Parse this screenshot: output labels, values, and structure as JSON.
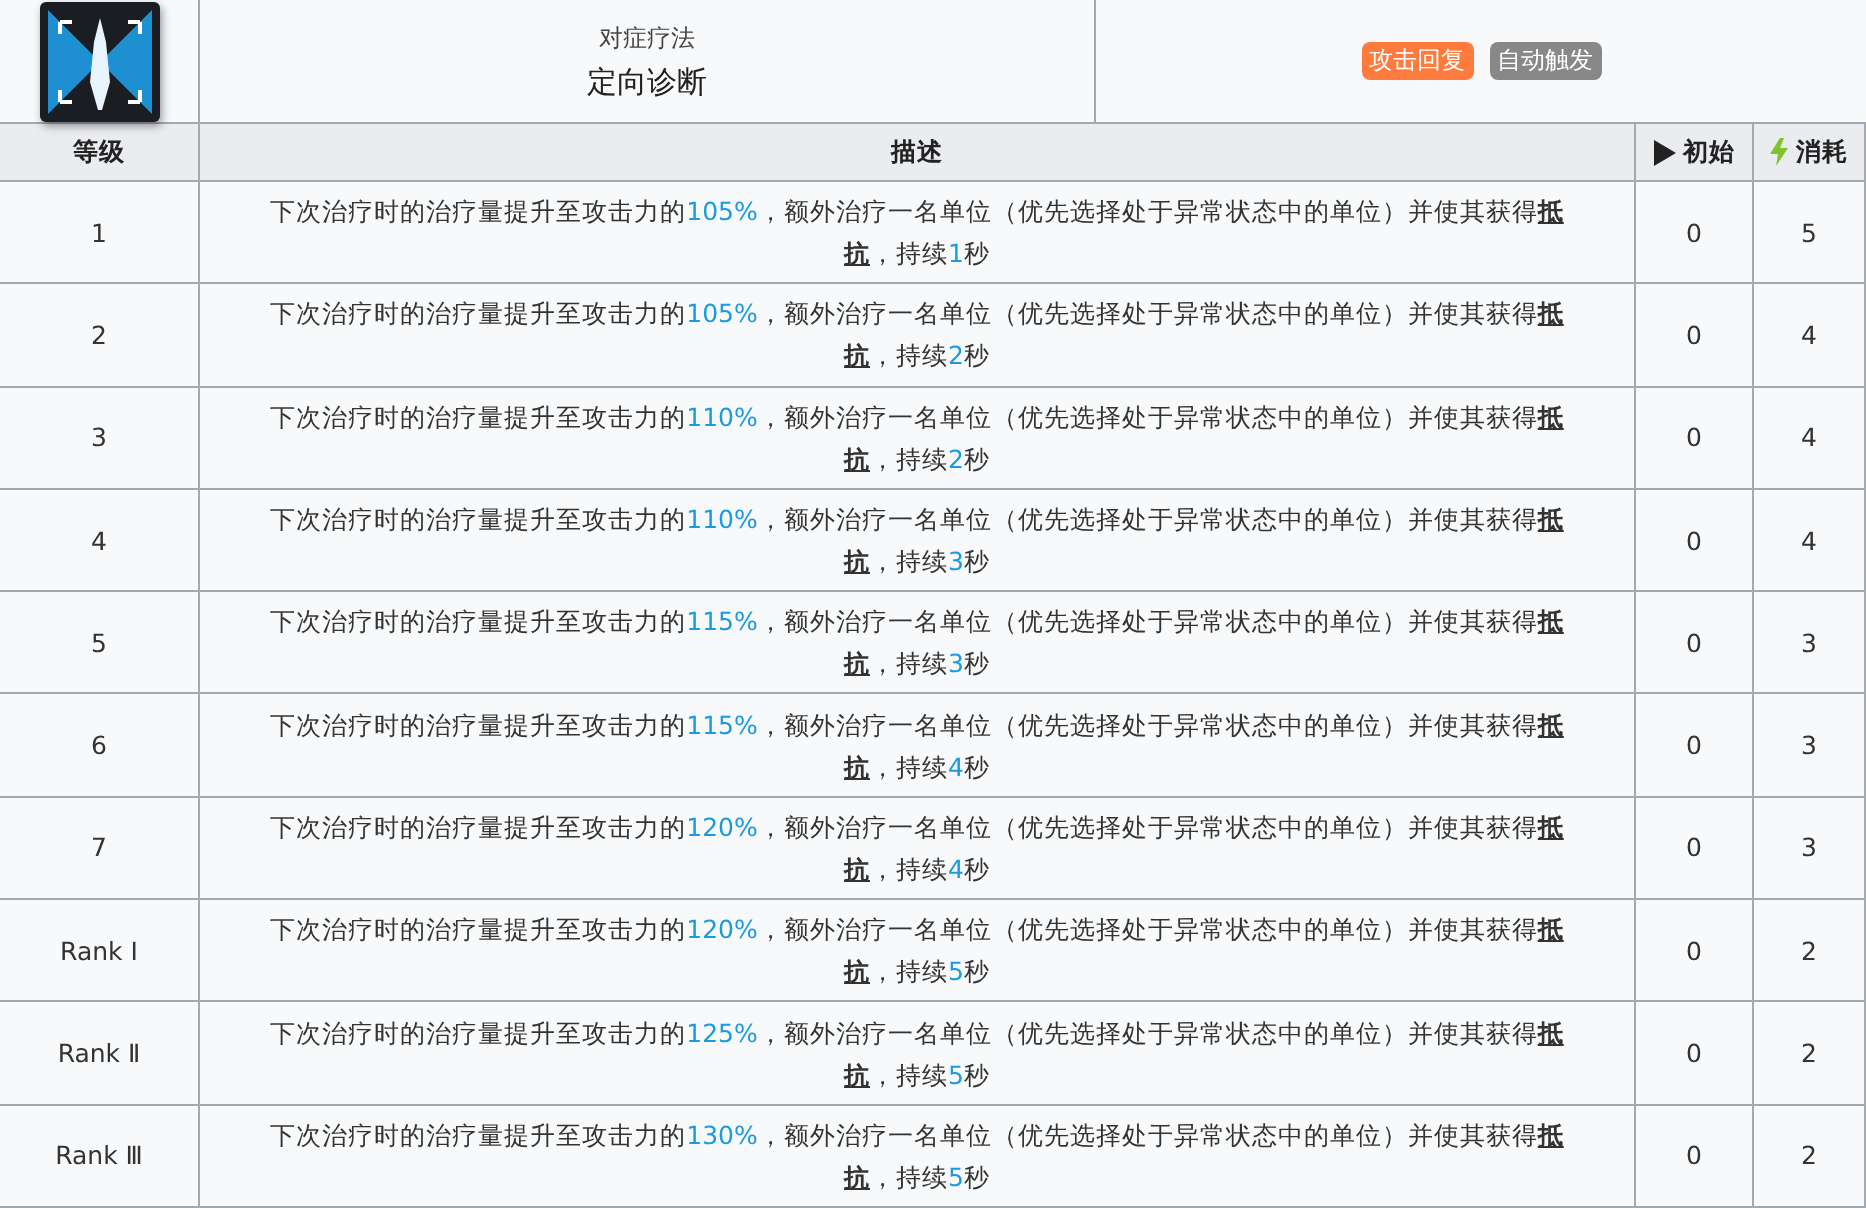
{
  "skill": {
    "type": "对症疗法",
    "name": "定向诊断",
    "tags": [
      {
        "label": "攻击回复",
        "color": "#ff7a3d"
      },
      {
        "label": "自动触发",
        "color": "#888888"
      }
    ]
  },
  "table": {
    "columns": [
      {
        "label": "等级",
        "kind": "level"
      },
      {
        "label": "描述",
        "kind": "description"
      },
      {
        "label": "初始",
        "kind": "initial"
      },
      {
        "label": "消耗",
        "kind": "cost"
      }
    ],
    "rows": [
      {
        "level": "1",
        "description": [
          {
            "kind": "text",
            "text": "下次治疗时的治疗量提升至攻击力的"
          },
          {
            "kind": "value",
            "text": "105%"
          },
          {
            "kind": "text",
            "text": "，额外治疗一名单位（优先选择处于异常状态中的单位）并使其获得"
          },
          {
            "kind": "term",
            "text": "抵抗"
          },
          {
            "kind": "text",
            "text": "，持续"
          },
          {
            "kind": "value",
            "text": "1"
          },
          {
            "kind": "text",
            "text": "秒"
          }
        ],
        "initial": "0",
        "cost": "5"
      },
      {
        "level": "2",
        "description": [
          {
            "kind": "text",
            "text": "下次治疗时的治疗量提升至攻击力的"
          },
          {
            "kind": "value",
            "text": "105%"
          },
          {
            "kind": "text",
            "text": "，额外治疗一名单位（优先选择处于异常状态中的单位）并使其获得"
          },
          {
            "kind": "term",
            "text": "抵抗"
          },
          {
            "kind": "text",
            "text": "，持续"
          },
          {
            "kind": "value",
            "text": "2"
          },
          {
            "kind": "text",
            "text": "秒"
          }
        ],
        "initial": "0",
        "cost": "4"
      },
      {
        "level": "3",
        "description": [
          {
            "kind": "text",
            "text": "下次治疗时的治疗量提升至攻击力的"
          },
          {
            "kind": "value",
            "text": "110%"
          },
          {
            "kind": "text",
            "text": "，额外治疗一名单位（优先选择处于异常状态中的单位）并使其获得"
          },
          {
            "kind": "term",
            "text": "抵抗"
          },
          {
            "kind": "text",
            "text": "，持续"
          },
          {
            "kind": "value",
            "text": "2"
          },
          {
            "kind": "text",
            "text": "秒"
          }
        ],
        "initial": "0",
        "cost": "4"
      },
      {
        "level": "4",
        "description": [
          {
            "kind": "text",
            "text": "下次治疗时的治疗量提升至攻击力的"
          },
          {
            "kind": "value",
            "text": "110%"
          },
          {
            "kind": "text",
            "text": "，额外治疗一名单位（优先选择处于异常状态中的单位）并使其获得"
          },
          {
            "kind": "term",
            "text": "抵抗"
          },
          {
            "kind": "text",
            "text": "，持续"
          },
          {
            "kind": "value",
            "text": "3"
          },
          {
            "kind": "text",
            "text": "秒"
          }
        ],
        "initial": "0",
        "cost": "4"
      },
      {
        "level": "5",
        "description": [
          {
            "kind": "text",
            "text": "下次治疗时的治疗量提升至攻击力的"
          },
          {
            "kind": "value",
            "text": "115%"
          },
          {
            "kind": "text",
            "text": "，额外治疗一名单位（优先选择处于异常状态中的单位）并使其获得"
          },
          {
            "kind": "term",
            "text": "抵抗"
          },
          {
            "kind": "text",
            "text": "，持续"
          },
          {
            "kind": "value",
            "text": "3"
          },
          {
            "kind": "text",
            "text": "秒"
          }
        ],
        "initial": "0",
        "cost": "3"
      },
      {
        "level": "6",
        "description": [
          {
            "kind": "text",
            "text": "下次治疗时的治疗量提升至攻击力的"
          },
          {
            "kind": "value",
            "text": "115%"
          },
          {
            "kind": "text",
            "text": "，额外治疗一名单位（优先选择处于异常状态中的单位）并使其获得"
          },
          {
            "kind": "term",
            "text": "抵抗"
          },
          {
            "kind": "text",
            "text": "，持续"
          },
          {
            "kind": "value",
            "text": "4"
          },
          {
            "kind": "text",
            "text": "秒"
          }
        ],
        "initial": "0",
        "cost": "3"
      },
      {
        "level": "7",
        "description": [
          {
            "kind": "text",
            "text": "下次治疗时的治疗量提升至攻击力的"
          },
          {
            "kind": "value",
            "text": "120%"
          },
          {
            "kind": "text",
            "text": "，额外治疗一名单位（优先选择处于异常状态中的单位）并使其获得"
          },
          {
            "kind": "term",
            "text": "抵抗"
          },
          {
            "kind": "text",
            "text": "，持续"
          },
          {
            "kind": "value",
            "text": "4"
          },
          {
            "kind": "text",
            "text": "秒"
          }
        ],
        "initial": "0",
        "cost": "3"
      },
      {
        "level": "Rank Ⅰ",
        "description": [
          {
            "kind": "text",
            "text": "下次治疗时的治疗量提升至攻击力的"
          },
          {
            "kind": "value",
            "text": "120%"
          },
          {
            "kind": "text",
            "text": "，额外治疗一名单位（优先选择处于异常状态中的单位）并使其获得"
          },
          {
            "kind": "term",
            "text": "抵抗"
          },
          {
            "kind": "text",
            "text": "，持续"
          },
          {
            "kind": "value",
            "text": "5"
          },
          {
            "kind": "text",
            "text": "秒"
          }
        ],
        "initial": "0",
        "cost": "2"
      },
      {
        "level": "Rank Ⅱ",
        "description": [
          {
            "kind": "text",
            "text": "下次治疗时的治疗量提升至攻击力的"
          },
          {
            "kind": "value",
            "text": "125%"
          },
          {
            "kind": "text",
            "text": "，额外治疗一名单位（优先选择处于异常状态中的单位）并使其获得"
          },
          {
            "kind": "term",
            "text": "抵抗"
          },
          {
            "kind": "text",
            "text": "，持续"
          },
          {
            "kind": "value",
            "text": "5"
          },
          {
            "kind": "text",
            "text": "秒"
          }
        ],
        "initial": "0",
        "cost": "2"
      },
      {
        "level": "Rank Ⅲ",
        "description": [
          {
            "kind": "text",
            "text": "下次治疗时的治疗量提升至攻击力的"
          },
          {
            "kind": "value",
            "text": "130%"
          },
          {
            "kind": "text",
            "text": "，额外治疗一名单位（优先选择处于异常状态中的单位）并使其获得"
          },
          {
            "kind": "term",
            "text": "抵抗"
          },
          {
            "kind": "text",
            "text": "，持续"
          },
          {
            "kind": "value",
            "text": "5"
          },
          {
            "kind": "text",
            "text": "秒"
          }
        ],
        "initial": "0",
        "cost": "2"
      }
    ]
  }
}
